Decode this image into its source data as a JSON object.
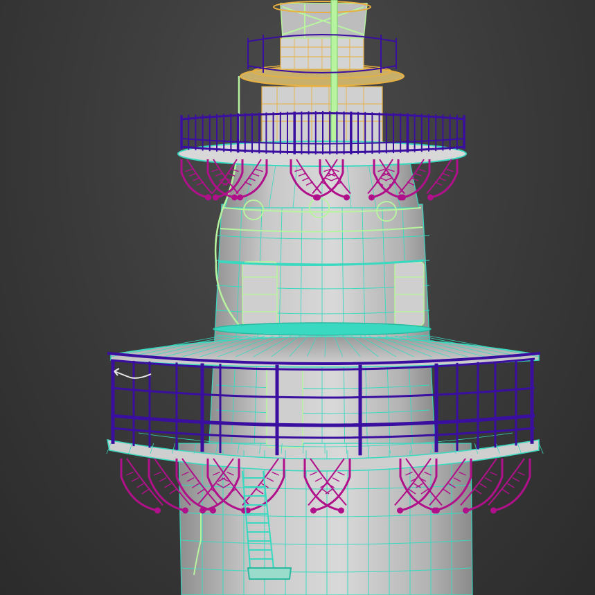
{
  "viewport": {
    "type": "3d-wireframe-viewport",
    "background": "#3d3d3d",
    "shading": "wireframe-over-shaded"
  },
  "scene": {
    "object": "lighthouse",
    "colors": {
      "tower_shaded": "#c8c8c8",
      "tower_wire": "#38d9c0",
      "light_wire": "#b8f4a0",
      "lantern_wire": "#e8b040",
      "railing_wire": "#3a0fa0",
      "corbel_wire": "#b0108a"
    }
  }
}
